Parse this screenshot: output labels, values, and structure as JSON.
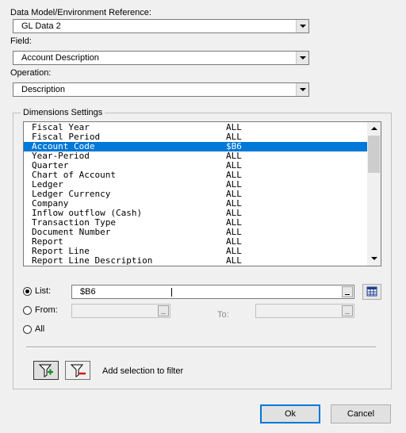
{
  "model": {
    "label": "Data Model/Environment Reference:",
    "value": "GL Data 2"
  },
  "field": {
    "label": "Field:",
    "value": "Account Description"
  },
  "operation": {
    "label": "Operation:",
    "value": "Description"
  },
  "dimensions": {
    "title": "Dimensions Settings",
    "rows": [
      {
        "name": "Fiscal Year",
        "value": "ALL"
      },
      {
        "name": "Fiscal Period",
        "value": "ALL"
      },
      {
        "name": "Account Code",
        "value": "$B6"
      },
      {
        "name": "Year-Period",
        "value": "ALL"
      },
      {
        "name": "Quarter",
        "value": "ALL"
      },
      {
        "name": "Chart of Account",
        "value": "ALL"
      },
      {
        "name": "Ledger",
        "value": "ALL"
      },
      {
        "name": "Ledger Currency",
        "value": "ALL"
      },
      {
        "name": "Company",
        "value": "ALL"
      },
      {
        "name": "Inflow outflow (Cash)",
        "value": "ALL"
      },
      {
        "name": "Transaction Type",
        "value": "ALL"
      },
      {
        "name": "Document Number",
        "value": "ALL"
      },
      {
        "name": "Report",
        "value": "ALL"
      },
      {
        "name": "Report Line",
        "value": "ALL"
      },
      {
        "name": "Report Line Description",
        "value": "ALL"
      }
    ],
    "selected_index": 2
  },
  "selection": {
    "list_label": "List:",
    "list_value": "$B6",
    "from_label": "From:",
    "from_value": "",
    "to_label": "To:",
    "to_value": "",
    "all_label": "All",
    "mode": "list"
  },
  "filter": {
    "add_label": "Add selection to filter",
    "add_icon": "filter-add-icon",
    "remove_icon": "filter-remove-icon"
  },
  "buttons": {
    "ok": "Ok",
    "cancel": "Cancel"
  },
  "colors": {
    "selection": "#0078d7",
    "background": "#f0f0f0"
  }
}
